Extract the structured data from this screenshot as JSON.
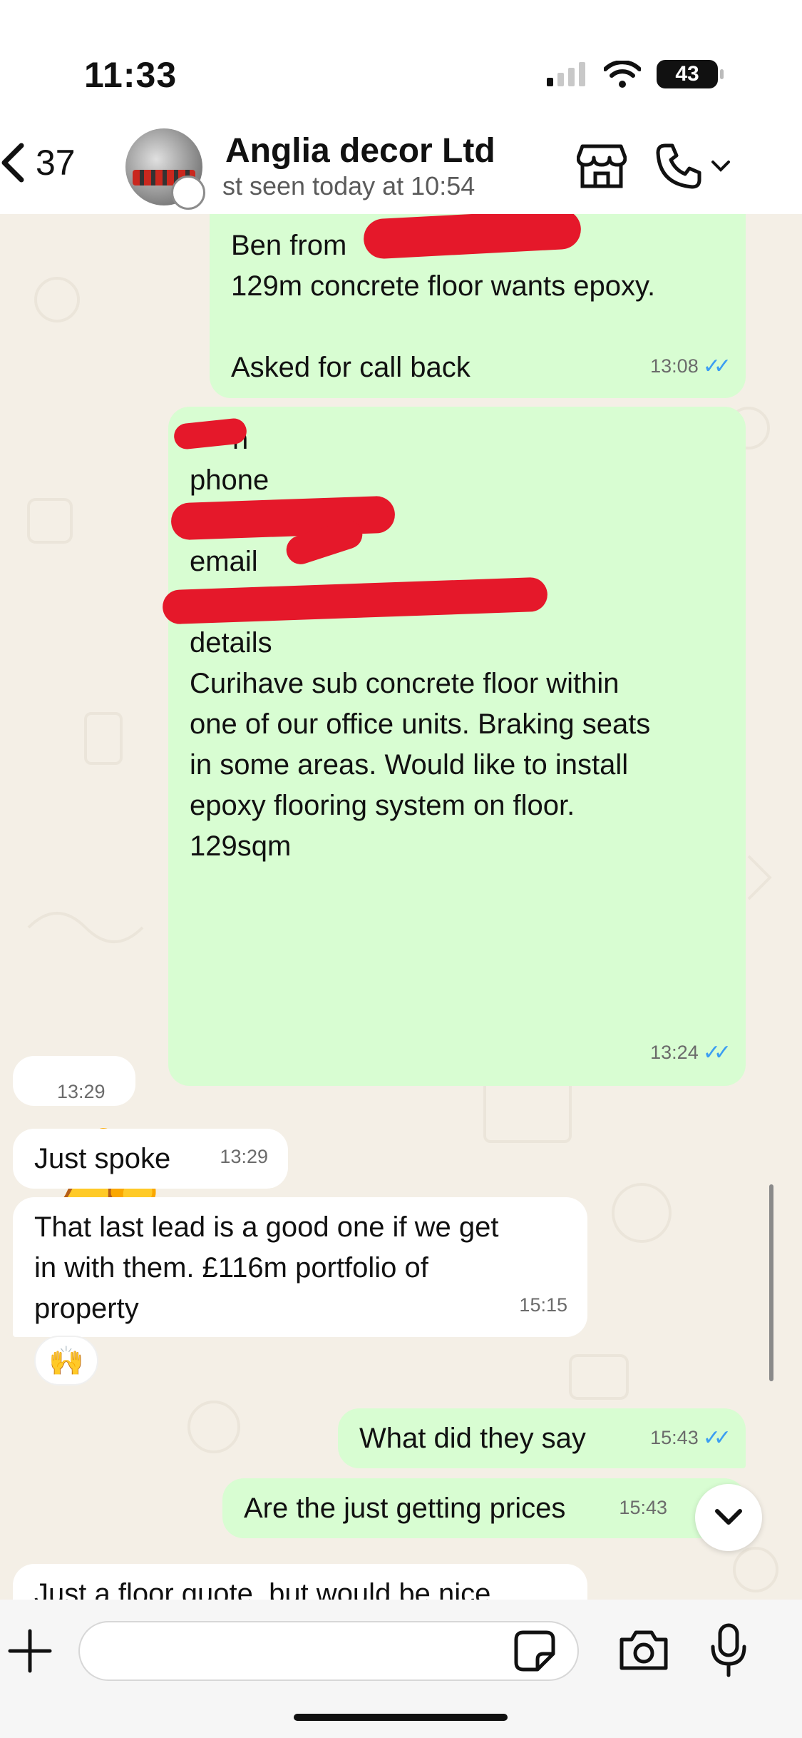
{
  "status_bar": {
    "time": "11:33",
    "battery": "43"
  },
  "header": {
    "back_count": "37",
    "contact_name": "Anglia decor Ltd",
    "contact_status": "st seen today at 10:54"
  },
  "messages": [
    {
      "id": "m1",
      "direction": "out",
      "lines": [
        "Ben from",
        "129m concrete floor wants epoxy.",
        "",
        "Asked for call back"
      ],
      "time": "13:08",
      "read": true
    },
    {
      "id": "m2",
      "direction": "out",
      "lines": [
        "n",
        "phone",
        "",
        "email",
        "",
        "details",
        "Curihave sub concrete floor within",
        "one of our office units. Braking seats",
        "in some areas. Would like to install",
        "epoxy flooring system on floor.",
        "129sqm"
      ],
      "time": "13:24",
      "read": true
    },
    {
      "id": "m3",
      "direction": "in",
      "emoji": "👍",
      "time": "13:29"
    },
    {
      "id": "m4",
      "direction": "in",
      "text": "Just spoke",
      "time": "13:29"
    },
    {
      "id": "m5",
      "direction": "in",
      "lines": [
        "That last lead is a good one if we get",
        "in with them. £116m portfolio of",
        "property"
      ],
      "time": "15:15",
      "reaction": "🙌"
    },
    {
      "id": "m6",
      "direction": "out",
      "text": "What did they say",
      "time": "15:43",
      "read": true
    },
    {
      "id": "m7",
      "direction": "out",
      "text": "Are the just getting prices",
      "time": "15:43"
    },
    {
      "id": "m8",
      "direction": "in",
      "text": "Just a floor quote, but would be nice"
    }
  ],
  "composer": {
    "placeholder": ""
  },
  "icons": {
    "back": "chevron-left-icon",
    "business": "shop-icon",
    "call": "phone-icon",
    "call_menu": "chevron-down-icon",
    "attach": "plus-icon",
    "sticker": "sticker-icon",
    "camera": "camera-icon",
    "mic": "microphone-icon",
    "scroll_down": "chevron-down-icon"
  },
  "colors": {
    "outgoing_bubble": "#d8fdd2",
    "incoming_bubble": "#ffffff",
    "chat_background": "#f4efe6",
    "read_ticks": "#3b9df2",
    "link": "#1e8a54",
    "redaction": "#e5182a"
  }
}
